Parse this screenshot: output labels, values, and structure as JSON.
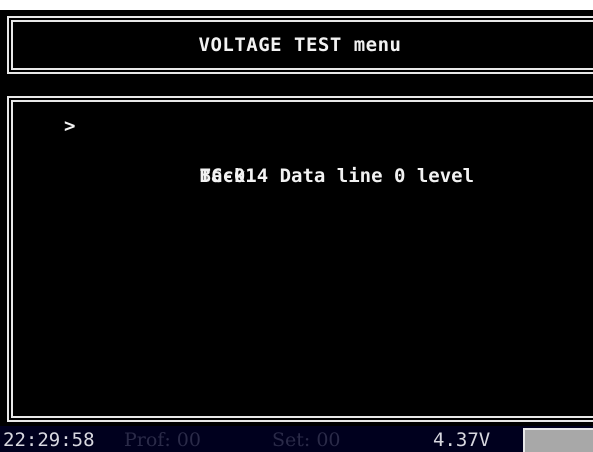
{
  "title": "VOLTAGE TEST menu",
  "menu": {
    "cursor_glyph": ">",
    "items": [
      {
        "label": "TC-014 Data line 0 level",
        "selected": true
      },
      {
        "label": "Back",
        "selected": false
      }
    ]
  },
  "status": {
    "time": "22:29:58",
    "profile": "Prof: 00",
    "set": "Set: 00",
    "voltage": "4.37V"
  },
  "colors": {
    "background": "#000000",
    "text": "#f2f2f2",
    "frame": "#e8e8e8",
    "status_bar": "#00001e",
    "status_dim_text": "#2a2a48",
    "status_box": "#a8a8a8"
  }
}
